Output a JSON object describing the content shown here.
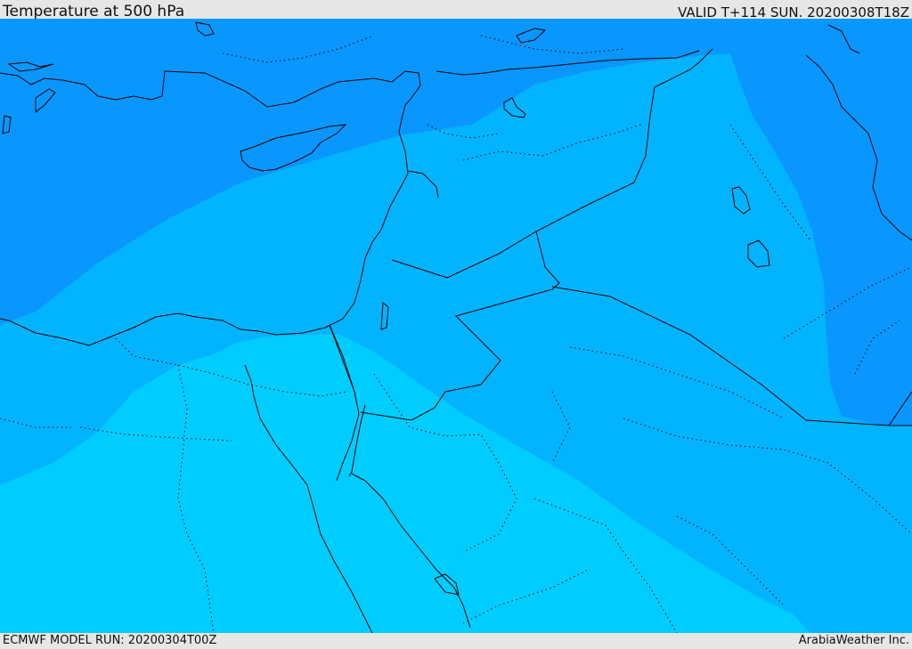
{
  "header": {
    "title": "Temperature at 500 hPa",
    "valid": "VALID T+114 SUN. 20200308T18Z"
  },
  "footer": {
    "model_run": "ECMWF MODEL RUN: 20200304T00Z",
    "credit": "ArabiaWeather Inc."
  },
  "colors": {
    "frame_background": "#e6e6e6",
    "band_coldest": "#0997ff",
    "band_mid": "#02b4ff",
    "band_warmest": "#00cdff",
    "coastline": "#000000",
    "borders": "#000000"
  }
}
